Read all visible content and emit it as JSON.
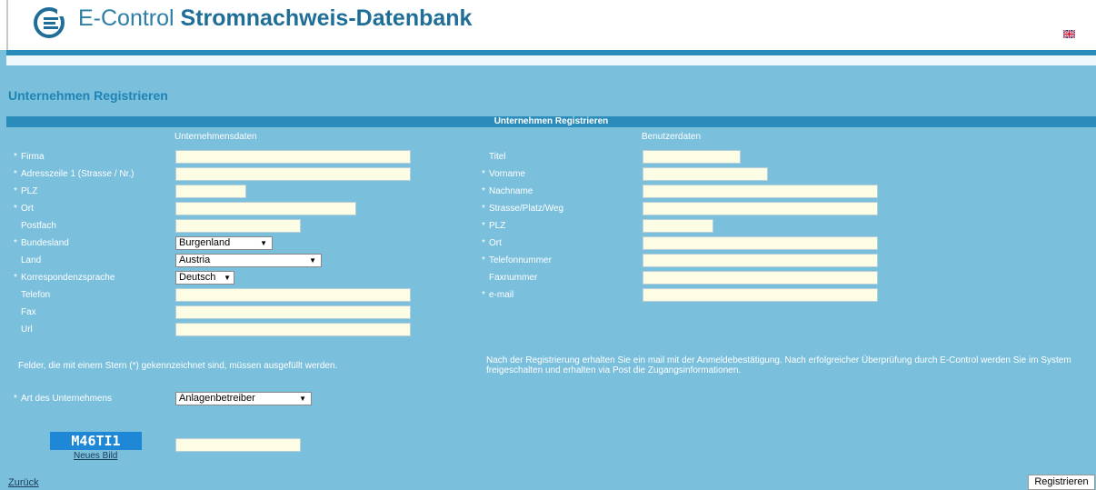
{
  "header": {
    "brand_prefix": "E-Control",
    "brand_name": "Stromnachweis-Datenbank",
    "logo_icon": "e-control-logo-icon",
    "language_icon": "uk-flag-icon"
  },
  "page_title": "Unternehmen Registrieren",
  "form_bar_title": "Unternehmen Registrieren",
  "company": {
    "heading": "Unternehmensdaten",
    "firma": "Firma",
    "adresse": "Adresszeile 1 (Strasse / Nr.)",
    "plz": "PLZ",
    "ort": "Ort",
    "postfach": "Postfach",
    "bundesland": "Bundesland",
    "bundesland_value": "Burgenland",
    "land": "Land",
    "land_value": "Austria",
    "sprache": "Korrespondenzsprache",
    "sprache_value": "Deutsch",
    "telefon": "Telefon",
    "fax": "Fax",
    "url": "Url"
  },
  "user": {
    "heading": "Benutzerdaten",
    "titel": "Titel",
    "vorname": "Vorname",
    "nachname": "Nachname",
    "strasse": "Strasse/Platz/Weg",
    "plz": "PLZ",
    "ort": "Ort",
    "telefonnummer": "Telefonnummer",
    "faxnummer": "Faxnummer",
    "email": "e-mail"
  },
  "required_note": "Felder, die mit einem Stern (*) gekennzeichnet sind, müssen ausgefüllt werden.",
  "info_line1": "Nach der Registrierung erhalten Sie ein mail mit der Anmeldebestätigung. Nach erfolgreicher Überprüfung durch E-Control werden Sie im System",
  "info_line2": "freigeschalten und erhalten via Post die Zugangsinformationen.",
  "art": {
    "label": "Art des Unternehmens",
    "value": "Anlagenbetreiber"
  },
  "captcha": {
    "text": "M46TI1",
    "new_image": "Neues Bild"
  },
  "back_link": "Zurück",
  "submit_button": "Registrieren",
  "required_marker": "*"
}
